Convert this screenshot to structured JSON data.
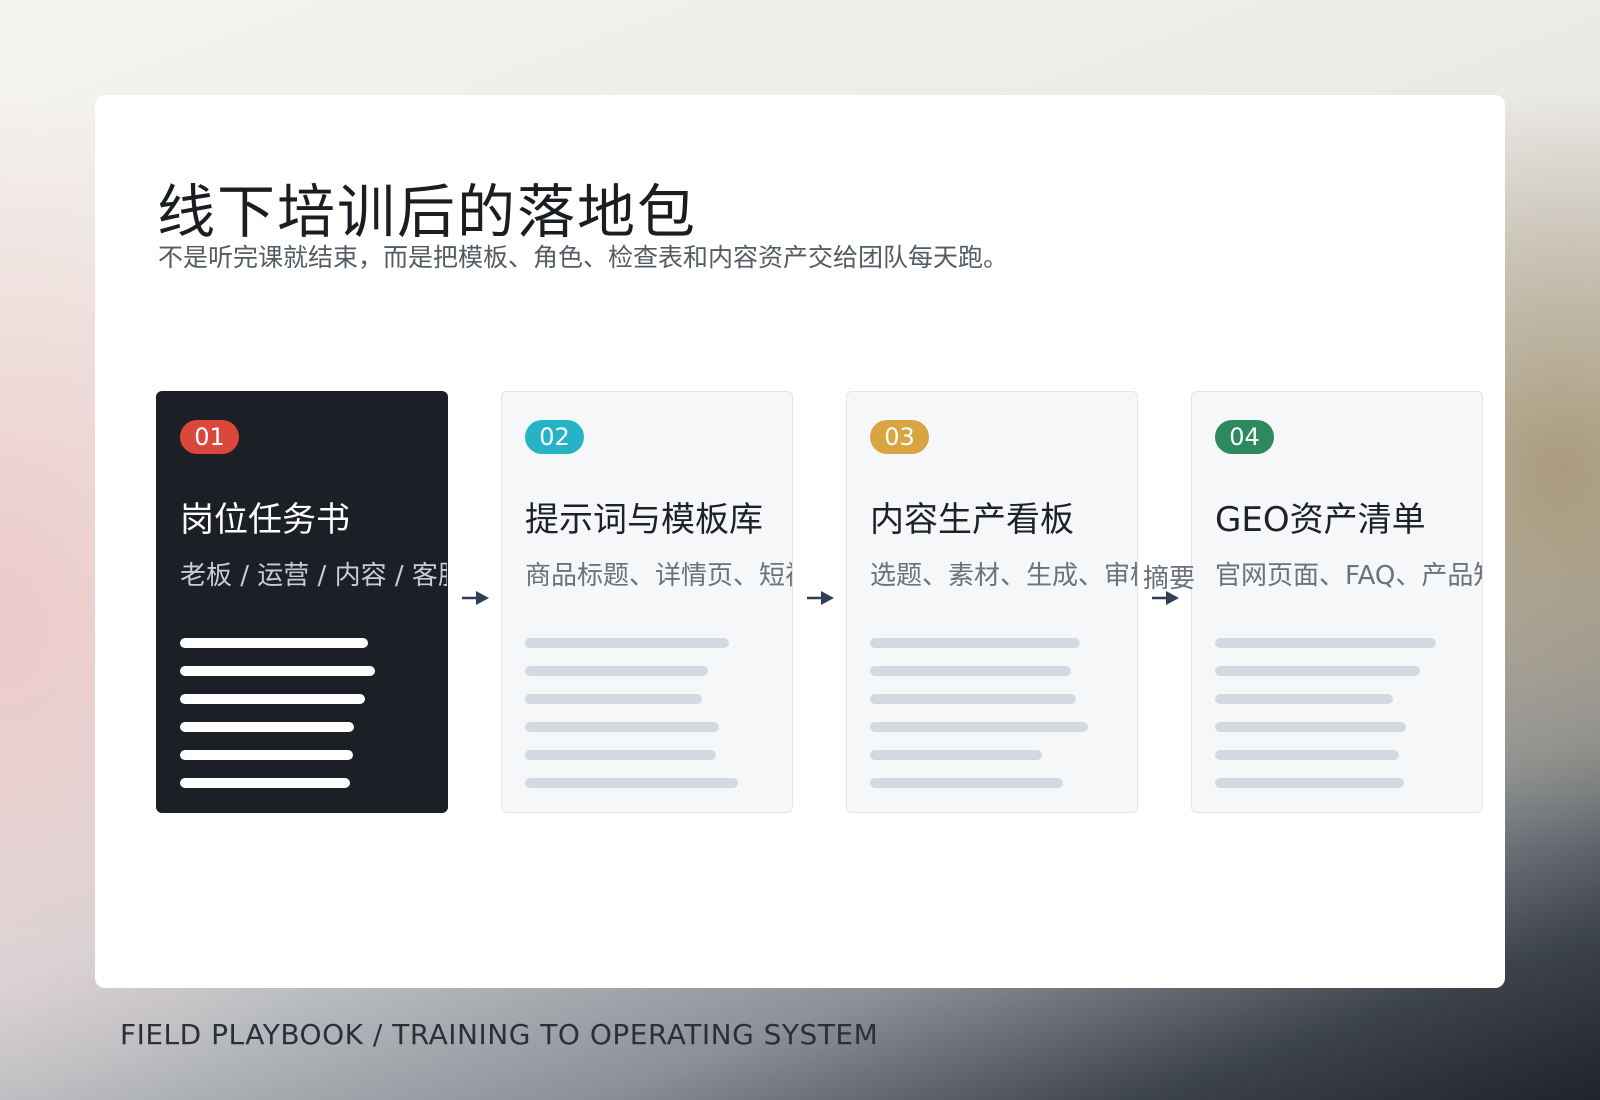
{
  "slide": {
    "title": "线下培训后的落地包",
    "subtitle": "不是听完课就结束，而是把模板、角色、检查表和内容资产交给团队每天跑。"
  },
  "cards": [
    {
      "number": "01",
      "title": "岗位任务书",
      "desc": "老板 / 运营 / 内容 / 客服分",
      "badge_color": "#d9483b",
      "dark": true
    },
    {
      "number": "02",
      "title": "提示词与模板库",
      "desc": "商品标题、详情页、短视频",
      "badge_color": "#27b3c6",
      "dark": false
    },
    {
      "number": "03",
      "title": "内容生产看板",
      "desc": "选题、素材、生成、审核、",
      "badge_color": "#d9a441",
      "dark": false
    },
    {
      "number": "04",
      "title": "GEO资产清单",
      "desc": "官网页面、FAQ、产品知识库、",
      "badge_color": "#2c8a5e",
      "dark": false
    }
  ],
  "arrow_overlap_text": "摘要",
  "footer": "FIELD PLAYBOOK  /  TRAINING TO OPERATING SYSTEM",
  "colors": {
    "dark_card": "#1c1f26",
    "light_card": "#f6f7f9",
    "arrow": "#2f3f55"
  }
}
